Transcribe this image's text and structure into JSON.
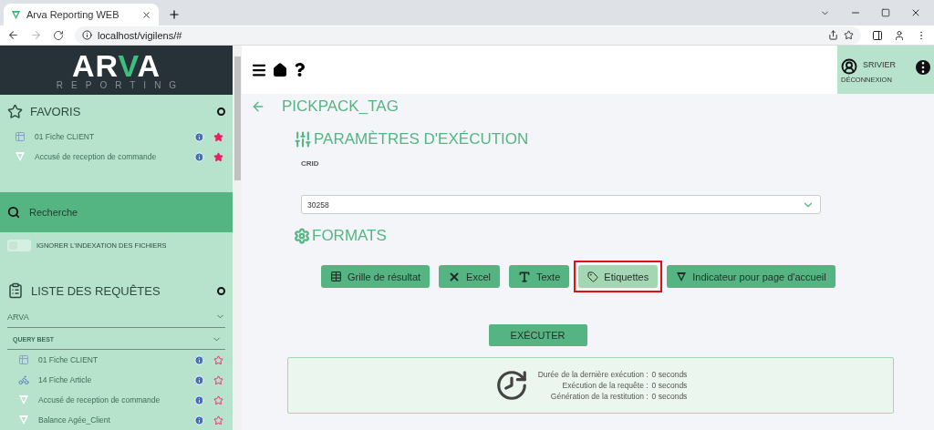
{
  "browser": {
    "tab_title": "Arva Reporting WEB",
    "url": "localhost/vigilens/#"
  },
  "logo": {
    "name": "ARVA",
    "subtitle": "REPORTING"
  },
  "favorites": {
    "title": "FAVORIS",
    "items": [
      {
        "label": "01 Fiche CLIENT",
        "kind": "grid",
        "favorite": true
      },
      {
        "label": "Accusé de reception de commande",
        "kind": "logo",
        "favorite": true
      }
    ]
  },
  "search": {
    "label": "Recherche"
  },
  "toggle": {
    "label": "IGNORER L'INDEXATION DES FICHIERS",
    "on": false
  },
  "queries": {
    "title": "LISTE DES REQUÊTES",
    "sections": [
      {
        "label": "ARVA",
        "kind": "group"
      },
      {
        "label": "QUERY BEST",
        "kind": "subgroup",
        "items": [
          {
            "label": "01 Fiche CLIENT",
            "kind": "grid",
            "favorite": false
          },
          {
            "label": "14 Fiche Article",
            "kind": "bike",
            "favorite": false
          },
          {
            "label": "Accusé de reception de commande",
            "kind": "logo",
            "favorite": false
          },
          {
            "label": "Balance Agée_Client",
            "kind": "logo",
            "favorite": false
          }
        ]
      }
    ]
  },
  "user": {
    "name": "SRIVIER",
    "logout": "DÉCONNEXION"
  },
  "page": {
    "title": "PICKPACK_TAG"
  },
  "params": {
    "title": "PARAMÈTRES D'EXÉCUTION",
    "field_label": "CRID",
    "field_value": "30258"
  },
  "formats": {
    "title": "FORMATS",
    "buttons": [
      {
        "label": "Grille de résultat",
        "kind": "table",
        "selected": false
      },
      {
        "label": "Excel",
        "kind": "excel",
        "selected": false
      },
      {
        "label": "Texte",
        "kind": "text",
        "selected": false
      },
      {
        "label": "Etiquettes",
        "kind": "tag",
        "selected": true
      },
      {
        "label": "Indicateur pour page d'accueil",
        "kind": "logo",
        "selected": false
      }
    ]
  },
  "execute": {
    "label": "EXÉCUTER"
  },
  "stats": [
    {
      "label": "Durée de la dernière exécution :",
      "value": "0 seconds"
    },
    {
      "label": "Exécution de la requête :",
      "value": "0 seconds"
    },
    {
      "label": "Génération de la restitution :",
      "value": "0 seconds"
    }
  ]
}
